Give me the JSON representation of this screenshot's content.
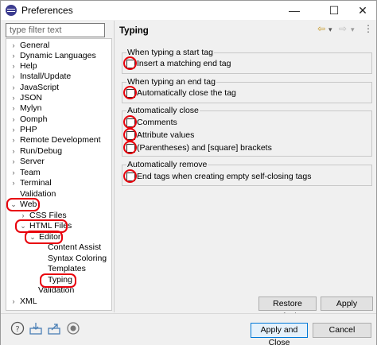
{
  "window": {
    "title": "Preferences"
  },
  "window_controls": {
    "minimize": "—",
    "maximize": "☐",
    "close": "✕"
  },
  "filter": {
    "placeholder": "type filter text"
  },
  "tree": {
    "items": [
      {
        "label": "General",
        "chevron": "›"
      },
      {
        "label": "Dynamic Languages",
        "chevron": "›"
      },
      {
        "label": "Help",
        "chevron": "›"
      },
      {
        "label": "Install/Update",
        "chevron": "›"
      },
      {
        "label": "JavaScript",
        "chevron": "›"
      },
      {
        "label": "JSON",
        "chevron": "›"
      },
      {
        "label": "Mylyn",
        "chevron": "›"
      },
      {
        "label": "Oomph",
        "chevron": "›"
      },
      {
        "label": "PHP",
        "chevron": "›"
      },
      {
        "label": "Remote Development",
        "chevron": "›"
      },
      {
        "label": "Run/Debug",
        "chevron": "›"
      },
      {
        "label": "Server",
        "chevron": "›"
      },
      {
        "label": "Team",
        "chevron": "›"
      },
      {
        "label": "Terminal",
        "chevron": "›"
      },
      {
        "label": "Validation",
        "chevron": ""
      },
      {
        "label": "Web",
        "chevron": "⌄"
      },
      {
        "label": "CSS Files",
        "chevron": "›"
      },
      {
        "label": "HTML Files",
        "chevron": "⌄"
      },
      {
        "label": "Editor",
        "chevron": "⌄"
      },
      {
        "label": "Content Assist",
        "chevron": ""
      },
      {
        "label": "Syntax Coloring",
        "chevron": ""
      },
      {
        "label": "Templates",
        "chevron": ""
      },
      {
        "label": "Typing",
        "chevron": ""
      },
      {
        "label": "Validation",
        "chevron": ""
      },
      {
        "label": "XML",
        "chevron": "›"
      }
    ]
  },
  "page": {
    "title": "Typing",
    "nav": {
      "back": "⇦",
      "back_menu": "▾",
      "forward": "⇨",
      "forward_menu": "▾",
      "menu": "⋮"
    }
  },
  "groups": [
    {
      "label": "When typing a start tag",
      "options": [
        "Insert a matching end tag"
      ]
    },
    {
      "label": "When typing an end tag",
      "options": [
        "Automatically close the tag"
      ]
    },
    {
      "label": "Automatically close",
      "options": [
        "Comments",
        "Attribute values",
        "(Parentheses) and [square] brackets"
      ]
    },
    {
      "label": "Automatically remove",
      "options": [
        "End tags when creating empty self-closing tags"
      ]
    }
  ],
  "buttons": {
    "restore_defaults": "Restore Defaults",
    "apply": "Apply",
    "apply_and_close": "Apply and Close",
    "cancel": "Cancel"
  },
  "colors": {
    "highlight": "#e8000b",
    "accent": "#0078d7"
  }
}
